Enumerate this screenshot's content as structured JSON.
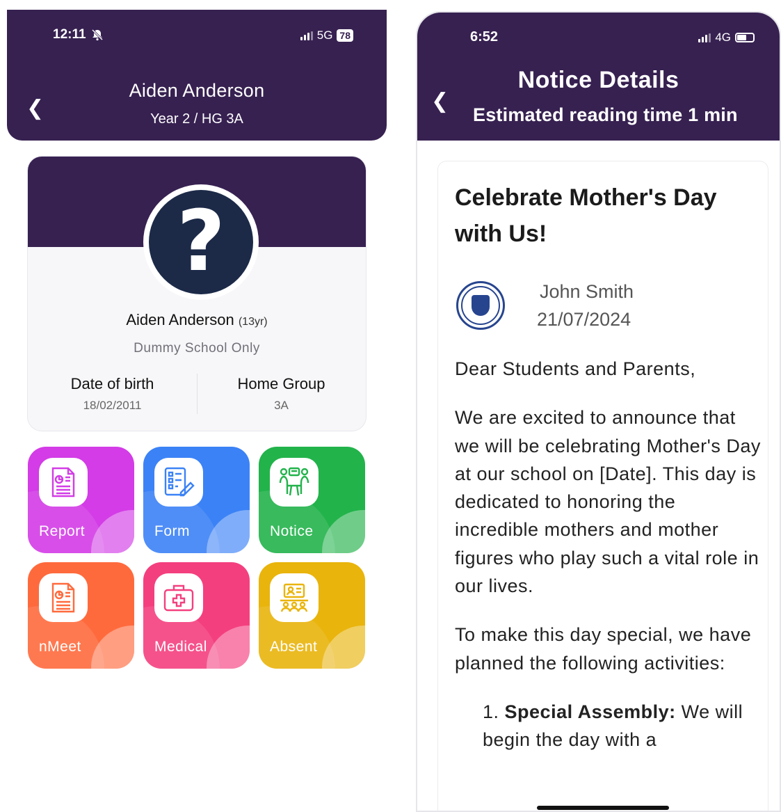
{
  "left_screen": {
    "status_bar": {
      "time": "12:11",
      "network": "5G",
      "battery": "78"
    },
    "header": {
      "title": "Aiden Anderson",
      "subtitle": "Year 2 / HG 3A"
    },
    "profile": {
      "name": "Aiden Anderson",
      "age": "(13yr)",
      "school": "Dummy School Only",
      "dob_label": "Date of birth",
      "dob_value": "18/02/2011",
      "home_group_label": "Home Group",
      "home_group_value": "3A"
    },
    "tiles": [
      {
        "label": "Report",
        "icon": "report-icon",
        "color": "#d33ce6"
      },
      {
        "label": "Form",
        "icon": "form-icon",
        "color": "#3b82f6"
      },
      {
        "label": "Notice",
        "icon": "notice-icon",
        "color": "#22b34b"
      },
      {
        "label": "nMeet",
        "icon": "meeting-icon",
        "color": "#ff6a3d"
      },
      {
        "label": "Medical",
        "icon": "medical-kit-icon",
        "color": "#f43f7e"
      },
      {
        "label": "Absent",
        "icon": "attendance-icon",
        "color": "#e9b40c"
      }
    ]
  },
  "right_screen": {
    "status_bar": {
      "time": "6:52",
      "network": "4G"
    },
    "header": {
      "title": "Notice Details",
      "subtitle": "Estimated reading time 1 min"
    },
    "notice": {
      "title": "Celebrate Mother's Day with Us!",
      "author": "John Smith",
      "date": "21/07/2024",
      "greeting": "Dear Students and Parents,",
      "paragraph1": "We are excited to announce that we will be celebrating Mother's Day at our school on [Date]. This day is dedicated to honoring the incredible mothers and mother figures who play such a vital role in our lives.",
      "paragraph2": "To make this day special, we have planned the following activities:",
      "list_item_1_title": "Special Assembly:",
      "list_item_1_text": " We will begin the day with a"
    }
  },
  "colors": {
    "header_purple": "#372151",
    "avatar_navy": "#1c2a48"
  }
}
